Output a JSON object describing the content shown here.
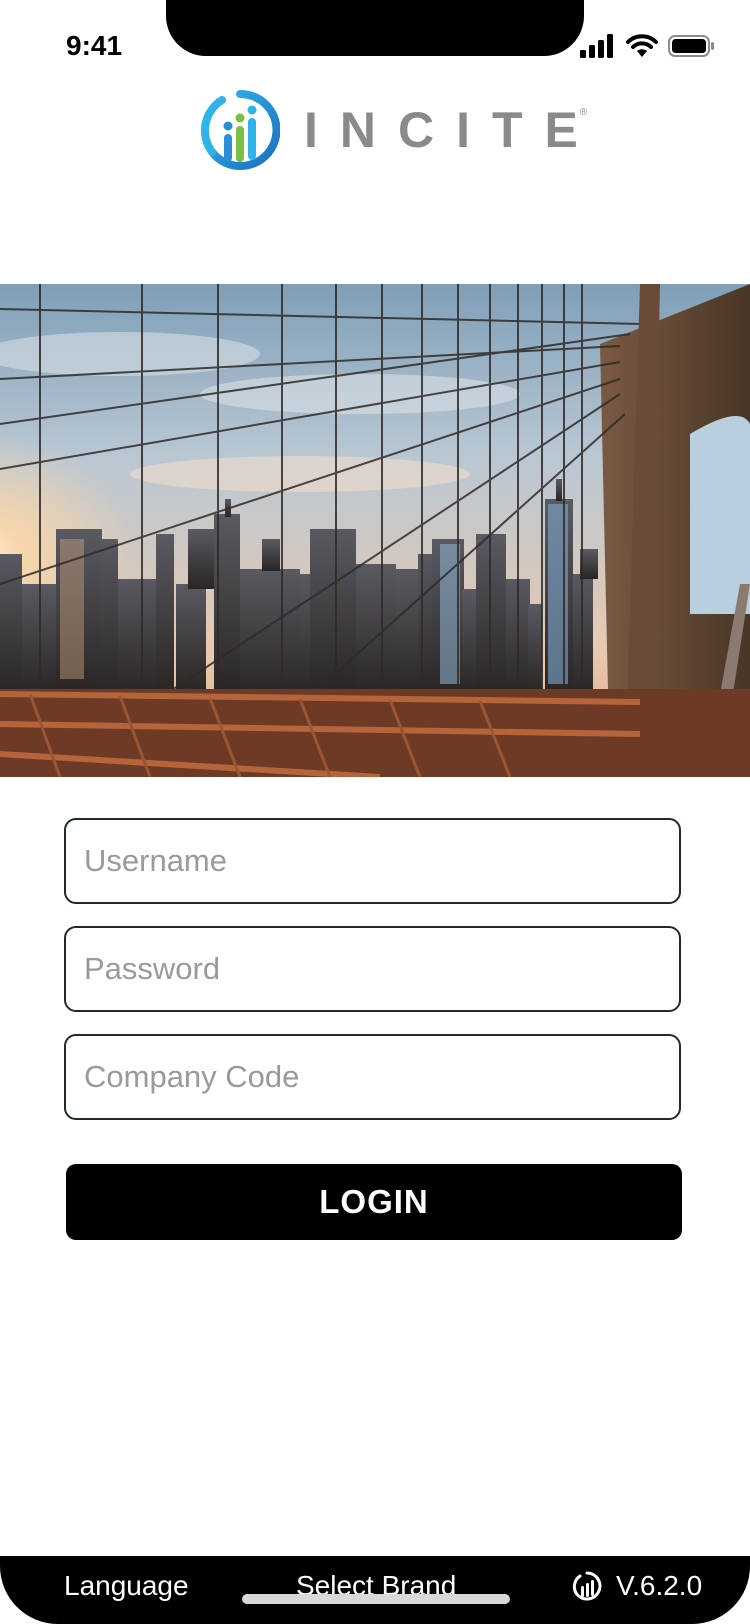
{
  "status": {
    "time": "9:41"
  },
  "brand": {
    "name": "INCITE",
    "registered": "®",
    "colors": {
      "blue": "#2a8fd6",
      "green": "#7ac143",
      "gray": "#8a8a8a"
    }
  },
  "form": {
    "username_placeholder": "Username",
    "password_placeholder": "Password",
    "company_code_placeholder": "Company Code",
    "login_label": "LOGIN"
  },
  "bottom_bar": {
    "language_label": "Language",
    "select_brand_label": "Select Brand",
    "version_label": "V.6.2.0",
    "version_icon": "incite-logo-icon"
  }
}
